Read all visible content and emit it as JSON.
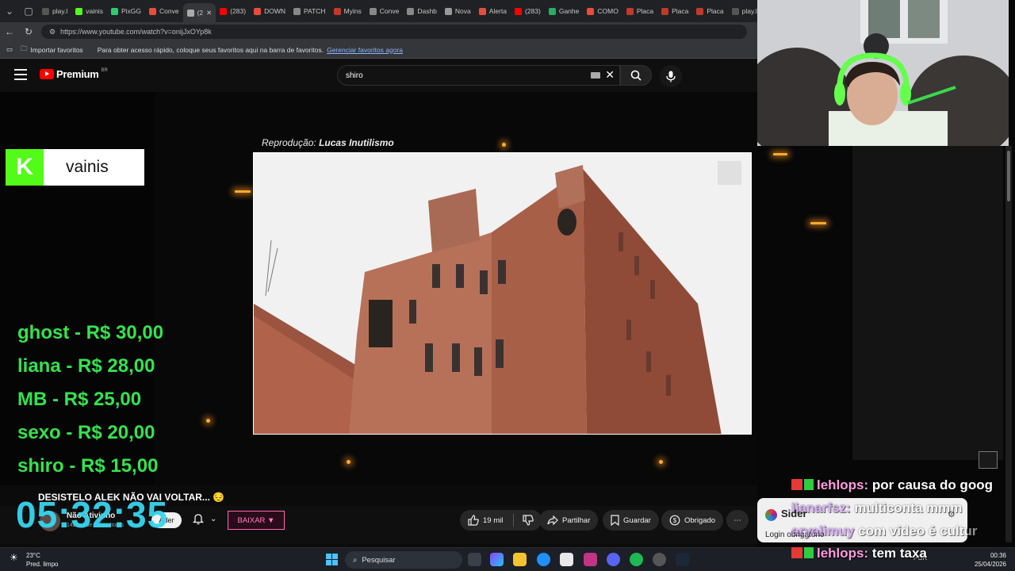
{
  "browser": {
    "tabs": [
      "play.l",
      "vainis",
      "PixGG",
      "Conve",
      "(2",
      "(283)",
      "DOWN",
      "PATCH",
      "Myins",
      "Conve",
      "Dashb",
      "Nova",
      "Alerta",
      "(283)",
      "Ganhe",
      "COMO",
      "Placa",
      "Placa",
      "Placa",
      "play.l"
    ],
    "url": "https://www.youtube.com/watch?v=onijJxOYp8k",
    "bookmarks": {
      "import_label": "Importar favoritos",
      "hint": "Para obter acesso rápido, coloque seus favoritos aqui na barra de favoritos.",
      "manage_link": "Gerenciar favoritos agora"
    }
  },
  "youtube": {
    "logo_text": "Premium",
    "logo_region": "BR",
    "search_value": "shiro"
  },
  "video": {
    "credit_prefix": "Reprodução:",
    "credit_name": "Lucas Inutilismo"
  },
  "overlay": {
    "streamer": "vainis",
    "kick_letter": "K",
    "prices": [
      "ghost - R$ 30,00",
      "liana - R$ 28,00",
      "MB - R$ 25,00",
      "sexo - R$ 20,00",
      "shiro - R$ 15,00"
    ],
    "clock": "05:32:35",
    "video_title": "DESISTELO ALEK NÃO VAI VOLTAR... 😔"
  },
  "actions": {
    "channel_name": "Não Ativinho",
    "channel_subs": "142 mil de subscritores",
    "aderir_label": "Ader",
    "baixar_label": "BAIXAR ▼",
    "likes": "19 mil",
    "share_label": "Partilhar",
    "save_label": "Guardar",
    "thanks_label": "Obrigado",
    "more_label": "⋯"
  },
  "chat": [
    {
      "user": "lehlops:",
      "message": "por causa do goog",
      "user_color": "#ff9de0"
    },
    {
      "user": "lianarfsz:",
      "message": "multiconta mmm",
      "user_color": "#c77dff"
    },
    {
      "user": "aryalimuy",
      "message": "com vídeo é cultur",
      "user_color": "#c77dff"
    },
    {
      "user": "lehlops:",
      "message": "tem taxa",
      "user_color": "#ff9de0"
    }
  ],
  "sider": {
    "title": "Sider",
    "login": "Login obrigatório"
  },
  "taskbar": {
    "weather_temp": "23°C",
    "weather_desc": "Pred. limpo",
    "search_label": "Pesquisar",
    "lang": "POR",
    "time": "00:36",
    "date": "25/04/2026"
  },
  "colors": {
    "price_green": "#34e34d",
    "clock_cyan": "#36d6f0",
    "kick_green": "#53fc18",
    "yt_red": "#ff0000",
    "baixar_pink": "#ff69b4"
  }
}
